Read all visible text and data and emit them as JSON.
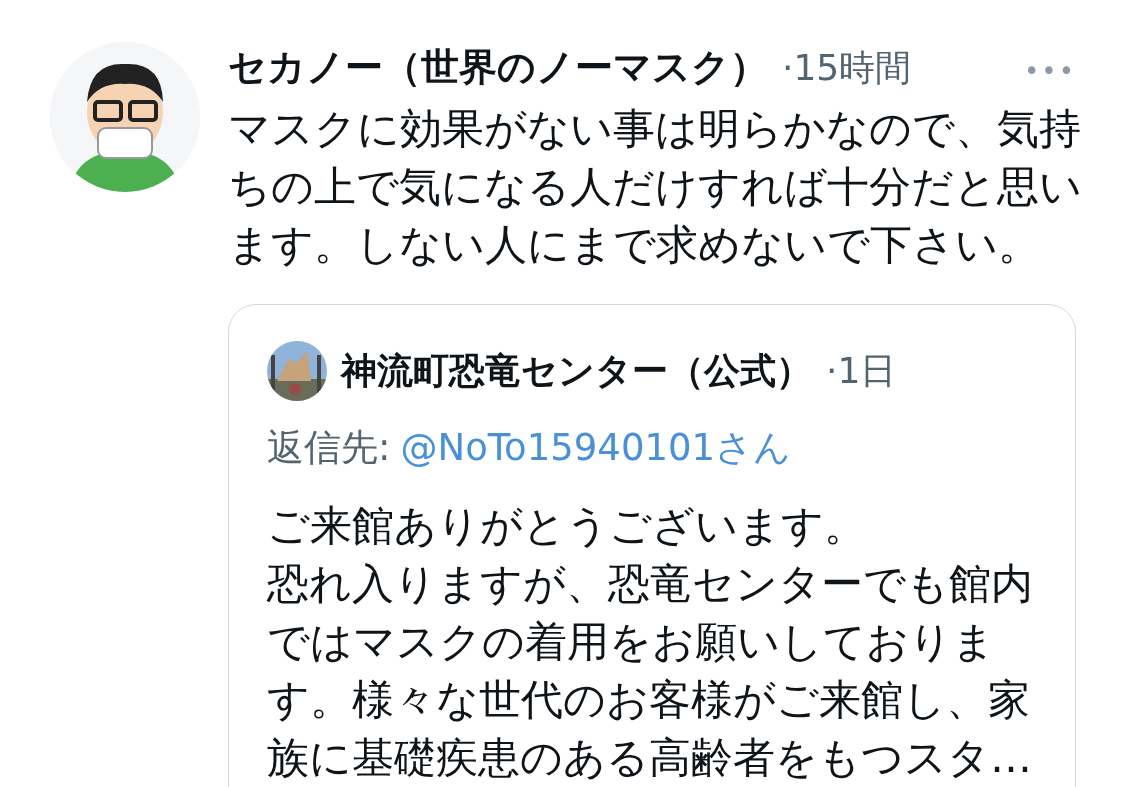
{
  "tweet": {
    "author": "セカノー（世界のノーマスク）",
    "time": "·15時間",
    "more": "•••",
    "text": "マスクに効果がない事は明らかなので、気持ちの上で気になる人だけすれば十分だと思います。しない人にまで求めないで下さい。",
    "quote": {
      "author": "神流町恐竜センター（公式）",
      "time": "·1日",
      "reply_label": "返信先:",
      "reply_handle": "@NoTo15940101さん",
      "paragraphs": [
        "ご来館ありがとうございます。",
        "恐れ入りますが、恐竜センターでも館内ではマスクの着用をお願いしております。様々な世代のお客様がご来館し、家族に基礎疾患のある高齢者をもつスタ…"
      ]
    }
  }
}
